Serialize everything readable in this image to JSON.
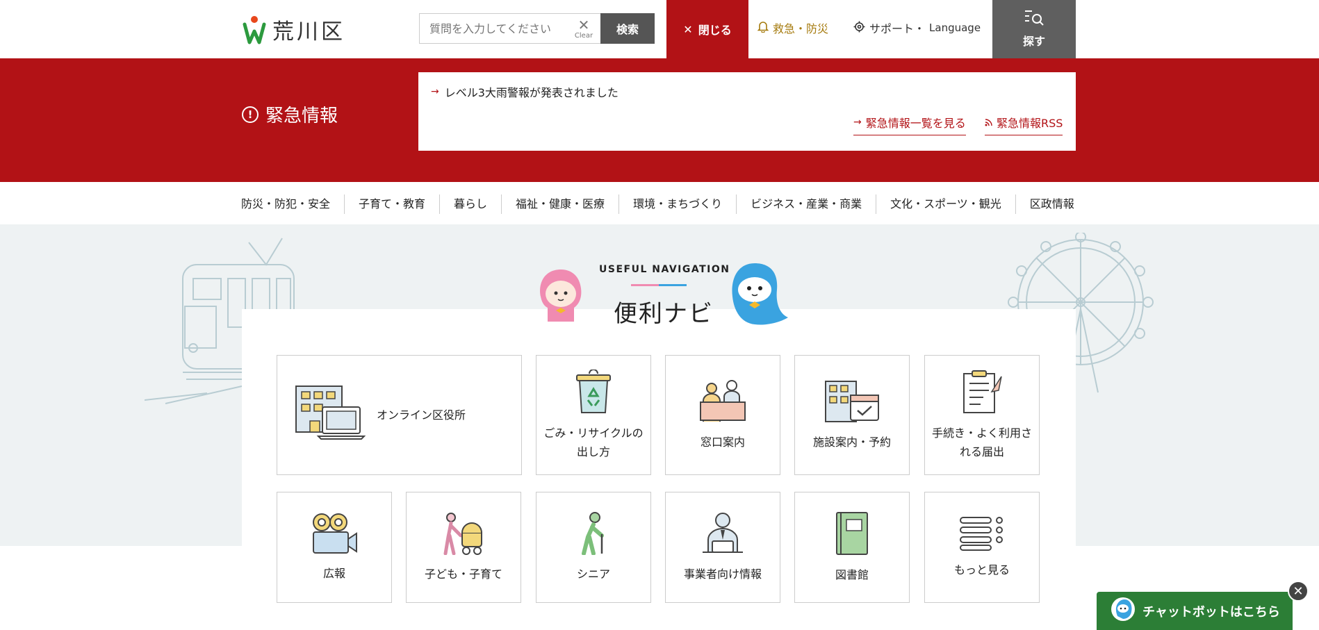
{
  "header": {
    "logo_text": "荒川区",
    "search": {
      "placeholder": "質問を入力してください",
      "clear_label": "Clear",
      "submit_label": "検索"
    },
    "close_label": "閉じる",
    "emergency_label": "救急・防災",
    "support_label": "サポート・",
    "language_label": "Language",
    "find_label": "探す"
  },
  "emergency": {
    "title": "緊急情報",
    "item": "レベル3大雨警報が発表されました",
    "list_link": "緊急情報一覧を見る",
    "rss_link": "緊急情報RSS"
  },
  "global_nav": [
    "防災・防犯・安全",
    "子育て・教育",
    "暮らし",
    "福祉・健康・医療",
    "環境・まちづくり",
    "ビジネス・産業・商業",
    "文化・スポーツ・観光",
    "区政情報"
  ],
  "useful_nav": {
    "en_title": "USEFUL NAVIGATION",
    "ja_title": "便利ナビ",
    "cards": {
      "online": "オンライン区役所",
      "garbage_1": "ごみ・リサイクルの",
      "garbage_2": "出し方",
      "counter": "窓口案内",
      "facility": "施設案内・予約",
      "procedure_1": "手続き・よく利用さ",
      "procedure_2": "れる届出",
      "pr": "広報",
      "kids": "子ども・子育て",
      "senior": "シニア",
      "business": "事業者向け情報",
      "library": "図書館",
      "more": "もっと見る"
    }
  },
  "chatbot": {
    "label": "チャットボットはこちら"
  },
  "colors": {
    "brand_red": "#b21216",
    "gold": "#a57a0d",
    "green": "#2c7e36",
    "gray_btn": "#5f5f5f",
    "pink": "#f08bb1",
    "blue": "#3aa3e0"
  }
}
